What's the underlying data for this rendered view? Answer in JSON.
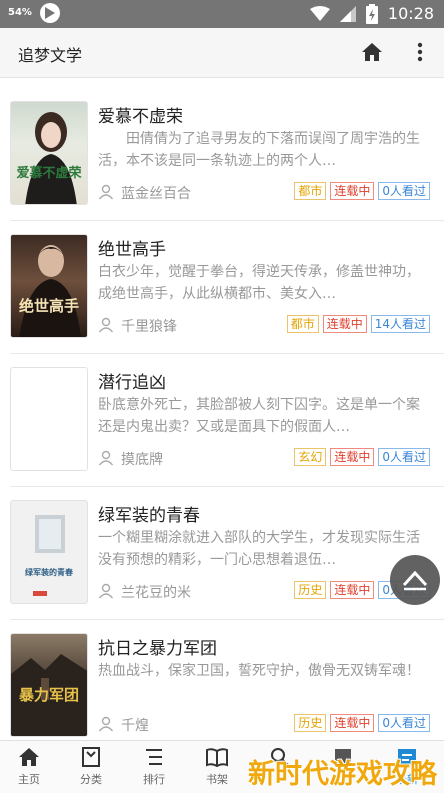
{
  "status_bar": {
    "battery_percent": "54%",
    "time": "10:28"
  },
  "app_bar": {
    "title": "追梦文学"
  },
  "books": [
    {
      "title": "爱慕不虚荣",
      "description": "　　田倩倩为了追寻男友的下落而误闯了周宇浩的生活，本不该是同一条轨迹上的两个人…",
      "author": "蓝金丝百合",
      "category": "都市",
      "status": "连载中",
      "readers": "0人看过",
      "cover_text": "爱慕不虚荣"
    },
    {
      "title": "绝世高手",
      "description": "白衣少年，觉醒于拳台，得逆天传承，修盖世神功，成绝世高手，从此纵横都市、美女入…",
      "author": "千里狼锋",
      "category": "都市",
      "status": "连载中",
      "readers": "14人看过",
      "cover_text": "绝世高手"
    },
    {
      "title": "潜行追凶",
      "description": "卧底意外死亡，其脸部被人刻下囚字。这是单一个案还是内鬼出卖？又或是面具下的假面人…",
      "author": "摸底牌",
      "category": "玄幻",
      "status": "连载中",
      "readers": "0人看过",
      "cover_text": ""
    },
    {
      "title": "绿军装的青春",
      "description": "一个糊里糊涂就进入部队的大学生，才发现实际生活没有预想的精彩，一门心思想着退伍…",
      "author": "兰花豆的米",
      "category": "历史",
      "status": "连载中",
      "readers": "0人看过",
      "cover_text": "绿军装的青春"
    },
    {
      "title": "抗日之暴力军团",
      "description": "热血战斗，保家卫国，誓死守护，傲骨无双铸军魂！",
      "author": "千煌",
      "category": "历史",
      "status": "连载中",
      "readers": "0人看过",
      "cover_text": "暴力军团"
    }
  ],
  "bottom_nav": {
    "items": [
      {
        "label": "主页",
        "icon": "home-icon"
      },
      {
        "label": "分类",
        "icon": "category-icon"
      },
      {
        "label": "排行",
        "icon": "ranking-icon"
      },
      {
        "label": "书架",
        "icon": "bookshelf-icon"
      },
      {
        "label": "",
        "icon": "search-icon"
      },
      {
        "label": "",
        "icon": "history-icon"
      },
      {
        "label": "最新",
        "icon": "latest-icon"
      }
    ]
  },
  "watermark": "新时代游戏攻略",
  "colors": {
    "status_bar": "#757575",
    "app_bar": "#f6f6f6",
    "tag_category": "#e5a400",
    "tag_status": "#e0402f",
    "tag_readers": "#3a86d6",
    "accent": "#1f8ad3",
    "watermark": "#f0a400"
  }
}
